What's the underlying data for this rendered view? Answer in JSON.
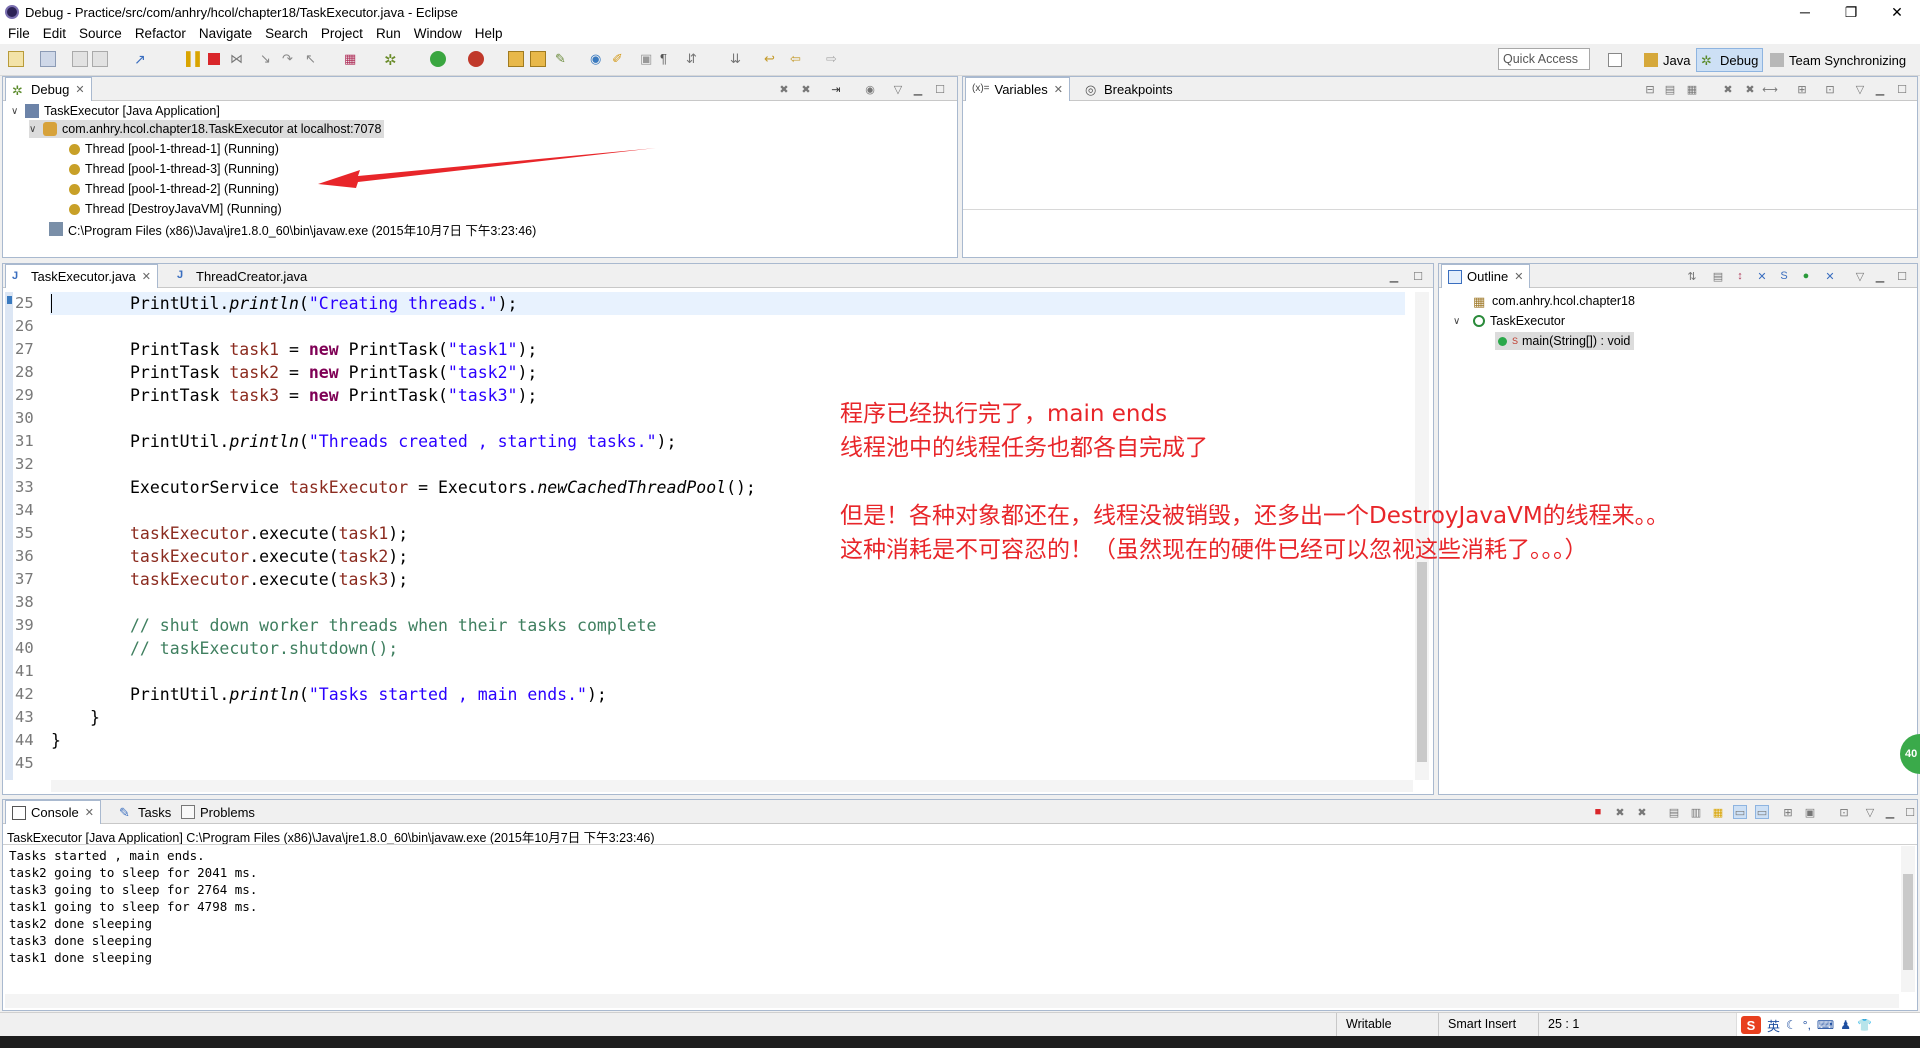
{
  "window": {
    "title": "Debug - Practice/src/com/anhry/hcol/chapter18/TaskExecutor.java - Eclipse"
  },
  "menu": [
    "File",
    "Edit",
    "Source",
    "Refactor",
    "Navigate",
    "Search",
    "Project",
    "Run",
    "Window",
    "Help"
  ],
  "toolbar": {
    "quick_access": "Quick Access",
    "perspectives": [
      "Java",
      "Debug",
      "Team Synchronizing"
    ]
  },
  "debug_view": {
    "tab": "Debug",
    "tree": [
      "TaskExecutor [Java Application]",
      "com.anhry.hcol.chapter18.TaskExecutor at localhost:7078",
      "Thread [pool-1-thread-1] (Running)",
      "Thread [pool-1-thread-3] (Running)",
      "Thread [pool-1-thread-2] (Running)",
      "Thread [DestroyJavaVM] (Running)",
      "C:\\Program Files (x86)\\Java\\jre1.8.0_60\\bin\\javaw.exe (2015年10月7日 下午3:23:46)"
    ]
  },
  "variables_view": {
    "tabs": [
      "Variables",
      "Breakpoints"
    ]
  },
  "editor": {
    "tabs": [
      "TaskExecutor.java",
      "ThreadCreator.java"
    ],
    "line_numbers": [
      "25",
      "26",
      "27",
      "28",
      "29",
      "30",
      "31",
      "32",
      "33",
      "34",
      "35",
      "36",
      "37",
      "38",
      "39",
      "40",
      "41",
      "42",
      "43",
      "44",
      "45"
    ],
    "lines": {
      "l25a": "PrintUtil.",
      "l25b": "println",
      "l25c": "(",
      "l25d": "\"Creating threads.\"",
      "l25e": ");",
      "l27a": "PrintTask ",
      "l27b": "task1",
      "l27c": " = ",
      "l27d": "new",
      "l27e": " PrintTask(",
      "l27f": "\"task1\"",
      "l27g": ");",
      "l28a": "PrintTask ",
      "l28b": "task2",
      "l28c": " = ",
      "l28d": "new",
      "l28e": " PrintTask(",
      "l28f": "\"task2\"",
      "l28g": ");",
      "l29a": "PrintTask ",
      "l29b": "task3",
      "l29c": " = ",
      "l29d": "new",
      "l29e": " PrintTask(",
      "l29f": "\"task3\"",
      "l29g": ");",
      "l31a": "PrintUtil.",
      "l31b": "println",
      "l31c": "(",
      "l31d": "\"Threads created , starting tasks.\"",
      "l31e": ");",
      "l33a": "ExecutorService ",
      "l33b": "taskExecutor",
      "l33c": " = Executors.",
      "l33d": "newCachedThreadPool",
      "l33e": "();",
      "l35a": "taskExecutor",
      "l35b": ".execute(",
      "l35c": "task1",
      "l35d": ");",
      "l36a": "taskExecutor",
      "l36b": ".execute(",
      "l36c": "task2",
      "l36d": ");",
      "l37a": "taskExecutor",
      "l37b": ".execute(",
      "l37c": "task3",
      "l37d": ");",
      "l39": "// shut down worker threads when their tasks complete",
      "l40": "// taskExecutor.shutdown();",
      "l42a": "PrintUtil.",
      "l42b": "println",
      "l42c": "(",
      "l42d": "\"Tasks started , main ends.\"",
      "l42e": ");",
      "l43": "}",
      "l44": "}"
    }
  },
  "outline_view": {
    "tab": "Outline",
    "items": [
      "com.anhry.hcol.chapter18",
      "TaskExecutor",
      "main(String[]) : void"
    ],
    "static_marker": "S"
  },
  "annotations": {
    "line1": "程序已经执行完了，main ends",
    "line2": "线程池中的线程任务也都各自完成了",
    "line3": "但是！各种对象都还在，线程没被销毁，还多出一个DestroyJavaVM的线程来。。",
    "line4": "这种消耗是不可容忍的！（虽然现在的硬件已经可以忽视这些消耗了。。。）"
  },
  "console_view": {
    "tabs": [
      "Console",
      "Tasks",
      "Problems"
    ],
    "header": "TaskExecutor [Java Application] C:\\Program Files (x86)\\Java\\jre1.8.0_60\\bin\\javaw.exe (2015年10月7日 下午3:23:46)",
    "lines": [
      "Tasks started , main ends.",
      "task2 going to sleep for 2041 ms.",
      "task3 going to sleep for 2764 ms.",
      "task1 going to sleep for 4798 ms.",
      "task2 done sleeping",
      "task3 done sleeping",
      "task1 done sleeping"
    ]
  },
  "statusbar": {
    "writable": "Writable",
    "insert": "Smart Insert",
    "position": "25 : 1"
  },
  "tray": {
    "ime_label": "英",
    "float_badge": "40"
  },
  "colors": {
    "accent_red": "#e8262a",
    "panel_border": "#a9b9cf",
    "keyword": "#7f0055",
    "string": "#2a00ff"
  }
}
